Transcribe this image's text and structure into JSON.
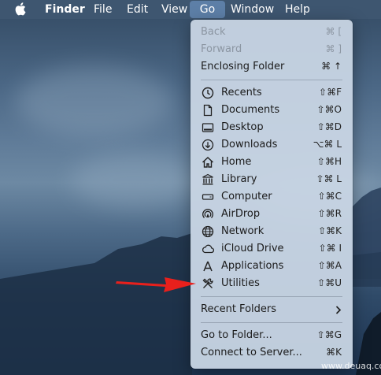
{
  "menubar": {
    "apple_icon": "apple-logo-icon",
    "items": [
      {
        "label": "Finder",
        "bold": true
      },
      {
        "label": "File"
      },
      {
        "label": "Edit"
      },
      {
        "label": "View"
      },
      {
        "label": "Go",
        "active": true
      },
      {
        "label": "Window"
      },
      {
        "label": "Help"
      }
    ]
  },
  "go_menu": {
    "items": [
      {
        "label": "Back",
        "shortcut": "⌘ [",
        "disabled": true
      },
      {
        "label": "Forward",
        "shortcut": "⌘ ]",
        "disabled": true
      },
      {
        "label": "Enclosing Folder",
        "shortcut": "⌘ ↑"
      },
      {
        "label": "Recents",
        "shortcut": "⇧⌘F",
        "icon": "clock-icon"
      },
      {
        "label": "Documents",
        "shortcut": "⇧⌘O",
        "icon": "document-icon"
      },
      {
        "label": "Desktop",
        "shortcut": "⇧⌘D",
        "icon": "desktop-icon"
      },
      {
        "label": "Downloads",
        "shortcut": "⌥⌘ L",
        "icon": "download-icon"
      },
      {
        "label": "Home",
        "shortcut": "⇧⌘H",
        "icon": "home-icon"
      },
      {
        "label": "Library",
        "shortcut": "⇧⌘ L",
        "icon": "library-icon"
      },
      {
        "label": "Computer",
        "shortcut": "⇧⌘C",
        "icon": "computer-icon"
      },
      {
        "label": "AirDrop",
        "shortcut": "⇧⌘R",
        "icon": "airdrop-icon"
      },
      {
        "label": "Network",
        "shortcut": "⇧⌘K",
        "icon": "network-globe-icon"
      },
      {
        "label": "iCloud Drive",
        "shortcut": "⇧⌘ I",
        "icon": "cloud-icon"
      },
      {
        "label": "Applications",
        "shortcut": "⇧⌘A",
        "icon": "applications-icon"
      },
      {
        "label": "Utilities",
        "shortcut": "⇧⌘U",
        "icon": "utilities-tools-icon"
      },
      {
        "label": "Recent Folders",
        "submenu": true
      },
      {
        "label": "Go to Folder...",
        "shortcut": "⇧⌘G"
      },
      {
        "label": "Connect to Server...",
        "shortcut": "⌘K"
      }
    ]
  },
  "annotation": {
    "arrow_color": "#e8201c"
  },
  "watermark": "www.deuaq.com"
}
